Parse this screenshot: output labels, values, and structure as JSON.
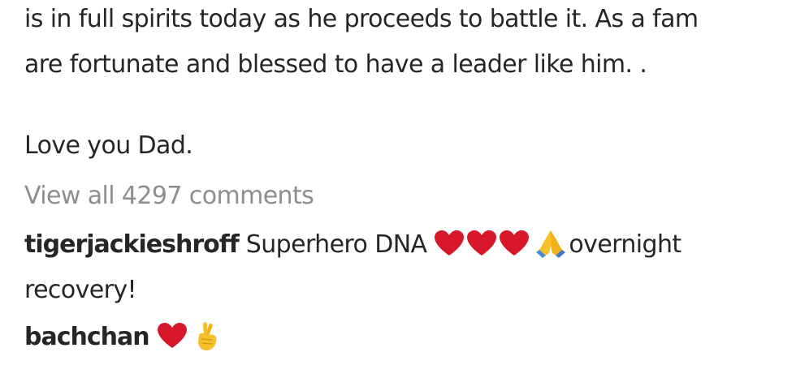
{
  "post": {
    "caption_line1": "is in full spirits today as he proceeds to battle it. As a fam",
    "caption_line2": "are fortunate and blessed to have a leader like him. .",
    "caption_line3": "Love you Dad.",
    "view_all_comments": "View all 4297 comments"
  },
  "comments": [
    {
      "username": "tigerjackieshroff",
      "text_before_emoji": "Superhero DNA",
      "emojis": [
        "red-heart",
        "red-heart",
        "red-heart",
        "folded-hands"
      ],
      "text_after_emoji": "overnight",
      "text_continued": "recovery!"
    },
    {
      "username": "bachchan",
      "emojis": [
        "red-heart",
        "crossed-fingers"
      ]
    }
  ],
  "colors": {
    "text": "#262626",
    "muted": "#8e8e8e",
    "heart": "#d6182a",
    "emoji_yellow": "#f6c02b"
  }
}
